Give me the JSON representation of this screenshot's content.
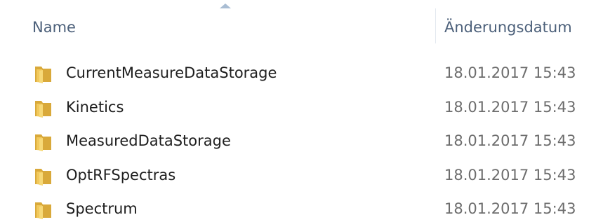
{
  "columns": {
    "name_label": "Name",
    "date_label": "Änderungsdatum",
    "sort_indicator": "sort-ascending"
  },
  "colors": {
    "folder_front": "#f2c95c",
    "folder_back": "#d9a93a",
    "header_text": "#4c607a",
    "date_text": "#6d6d6d"
  },
  "files": [
    {
      "name": "CurrentMeasureDataStorage",
      "modified": "18.01.2017 15:43",
      "icon": "folder-icon"
    },
    {
      "name": "Kinetics",
      "modified": "18.01.2017 15:43",
      "icon": "folder-icon"
    },
    {
      "name": "MeasuredDataStorage",
      "modified": "18.01.2017 15:43",
      "icon": "folder-icon"
    },
    {
      "name": "OptRFSpectras",
      "modified": "18.01.2017 15:43",
      "icon": "folder-icon"
    },
    {
      "name": "Spectrum",
      "modified": "18.01.2017 15:43",
      "icon": "folder-icon"
    }
  ]
}
